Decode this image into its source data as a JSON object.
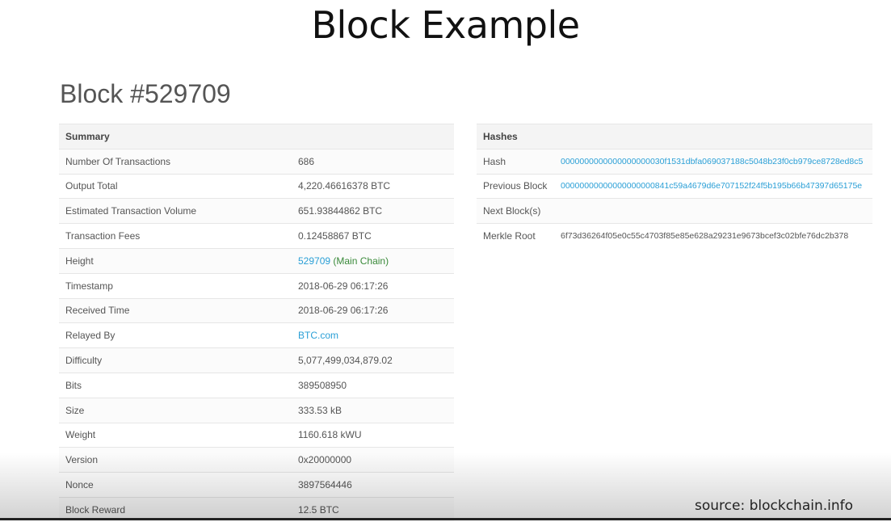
{
  "slide_title": "Block Example",
  "block_title": "Block #529709",
  "summary": {
    "header": "Summary",
    "rows": [
      {
        "label": "Number Of Transactions",
        "value": "686"
      },
      {
        "label": "Output Total",
        "value": "4,220.46616378 BTC"
      },
      {
        "label": "Estimated Transaction Volume",
        "value": "651.93844862 BTC"
      },
      {
        "label": "Transaction Fees",
        "value": "0.12458867 BTC"
      },
      {
        "label": "Height",
        "value": "529709",
        "extra": "(Main Chain)"
      },
      {
        "label": "Timestamp",
        "value": "2018-06-29 06:17:26"
      },
      {
        "label": "Received Time",
        "value": "2018-06-29 06:17:26"
      },
      {
        "label": "Relayed By",
        "value": "BTC.com"
      },
      {
        "label": "Difficulty",
        "value": "5,077,499,034,879.02"
      },
      {
        "label": "Bits",
        "value": "389508950"
      },
      {
        "label": "Size",
        "value": "333.53 kB"
      },
      {
        "label": "Weight",
        "value": "1160.618 kWU"
      },
      {
        "label": "Version",
        "value": "0x20000000"
      },
      {
        "label": "Nonce",
        "value": "3897564446"
      },
      {
        "label": "Block Reward",
        "value": "12.5 BTC"
      }
    ]
  },
  "hashes": {
    "header": "Hashes",
    "rows": [
      {
        "label": "Hash",
        "value": "0000000000000000000030f1531dbfa069037188c5048b23f0cb979ce8728ed8c5"
      },
      {
        "label": "Previous Block",
        "value": "00000000000000000000841c59a4679d6e707152f24f5b195b66b47397d65175e"
      },
      {
        "label": "Next Block(s)",
        "value": ""
      },
      {
        "label": "Merkle Root",
        "value": "6f73d36264f05e0c55c4703f85e85e628a29231e9673bcef3c02bfe76dc2b378"
      }
    ]
  },
  "source": "source: blockchain.info"
}
